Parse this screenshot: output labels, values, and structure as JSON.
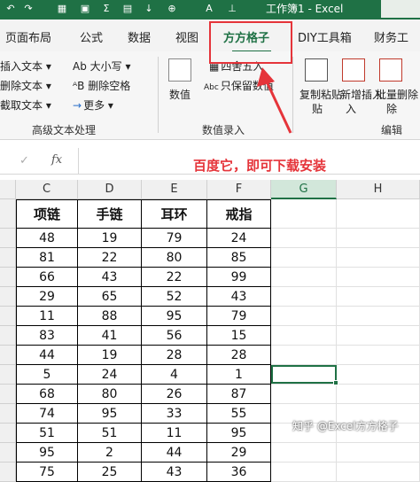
{
  "titlebar": {
    "doc_title": "工作簿1 - Excel",
    "bg": "#1f7145"
  },
  "tabs": [
    "页面布局",
    "公式",
    "数据",
    "视图",
    "方方格子",
    "DIY工具箱",
    "财务工"
  ],
  "active_tab": "方方格子",
  "ribbon": {
    "group1_items": [
      "插入文本",
      "删除文本",
      "截取文本"
    ],
    "group1b_items": [
      "Ab 大小写",
      "ᴬB 删除空格",
      "更多"
    ],
    "group1_label": "高级文本处理",
    "group2_big": "数值",
    "group2_items": [
      "四舍五入",
      "只保留数值"
    ],
    "group2_label": "数值录入",
    "group3_items": [
      "复制粘贴",
      "新增插入",
      "批量删除"
    ],
    "group3_subitems": [
      "贴",
      "入",
      "除"
    ],
    "group3_label": "编辑"
  },
  "formula_bar": {
    "x": "✓",
    "fx": "fx"
  },
  "annotation": "百度它，即可下载安装",
  "columns": [
    "C",
    "D",
    "E",
    "F",
    "G",
    "H"
  ],
  "table": {
    "headers": [
      "项链",
      "手链",
      "耳环",
      "戒指"
    ],
    "rows": [
      [
        48,
        19,
        79,
        24
      ],
      [
        81,
        22,
        80,
        85
      ],
      [
        66,
        43,
        22,
        99
      ],
      [
        29,
        65,
        52,
        43
      ],
      [
        11,
        88,
        95,
        79
      ],
      [
        83,
        41,
        56,
        15
      ],
      [
        44,
        19,
        28,
        28
      ],
      [
        5,
        24,
        4,
        1
      ],
      [
        68,
        80,
        26,
        87
      ],
      [
        74,
        95,
        33,
        55
      ],
      [
        51,
        51,
        11,
        95
      ],
      [
        95,
        2,
        44,
        29
      ],
      [
        75,
        25,
        43,
        36
      ]
    ]
  },
  "watermark": "知乎 @Excel方方格子",
  "accent": "#1f7145",
  "highlight": "#e5343a"
}
